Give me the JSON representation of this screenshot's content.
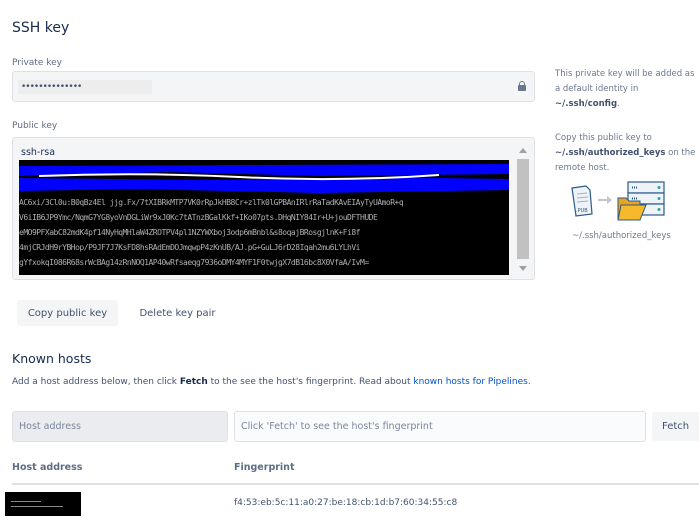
{
  "ssh_key": {
    "title": "SSH key",
    "private_key": {
      "label": "Private key",
      "value": "••••••••••••••",
      "help_prefix": "This private key will be added as a default identity in ",
      "help_path": "~/.ssh/config",
      "help_suffix": "."
    },
    "public_key": {
      "label": "Public key",
      "prefix": "ssh-rsa",
      "redacted": true,
      "visible_lines": [
        "AC6xi/3Cl0u:B0qBz4El jjg.Fx/7tXIBRkMTP7VK0rRpJkHB8Cr+zlTk0lGPBAnIRlrRaTadKAvEIAyTyUAmoR+q",
        "V6iIB6JP9Ymc/NqmG7YG8yoVnDGLiWr9xJ0Kc7tATnzBGalKkf+IKo07pts.DHqNIY84Ir+U+jouDFTHUDE",
        "eMO9PFXabC82mdK4pf14NyHqMHlaW4ZROTPV4pl1NZYWXboj3odp6mBnbl&s8oqajBRosgjlnK+Fi8f",
        "4mjCRJdH9rYBHop/P9JF7J7KsFD8hsRAdEmDOJmqwpP4zKnUB/AJ.pG+GuLJ6rD28Iqah2mu6LYLhVi",
        "gYfxokqI086R68srWcBAg14zRnNOQ1AP40wRfsaeqg7936oDMY4MYF1F0twjgX7dB16bc8X0VfaA/IvM="
      ],
      "help_prefix": "Copy this public key to ",
      "help_path": "~/.ssh/authorized_keys",
      "help_suffix": " on the remote host.",
      "illustration_caption": "~/.ssh/authorized_keys",
      "file_badge": ".PUB"
    },
    "actions": {
      "copy_label": "Copy public key",
      "delete_label": "Delete key pair"
    }
  },
  "known_hosts": {
    "title": "Known hosts",
    "description_prefix": "Add a host address below, then click ",
    "description_bold": "Fetch",
    "description_middle": " to the see the host's fingerprint. Read about ",
    "description_link": "known hosts for Pipelines",
    "description_suffix": ".",
    "host_input": {
      "placeholder": "Host address",
      "value": ""
    },
    "fingerprint_input": {
      "placeholder": "Click 'Fetch' to see the host's fingerprint",
      "value": ""
    },
    "fetch_label": "Fetch",
    "table": {
      "columns": [
        "Host address",
        "Fingerprint"
      ],
      "rows": [
        {
          "host": "[redacted]",
          "fingerprint": "f4:53:eb:5c:11:a0:27:be:18:cb:1d:b7:60:34:55:c8"
        }
      ]
    }
  },
  "colors": {
    "link": "#0052cc",
    "heading": "#172b4d",
    "muted": "#6b778c",
    "folder": "#f6b92b",
    "server": "#2a5a8a",
    "redaction_blue": "#0000ff"
  }
}
